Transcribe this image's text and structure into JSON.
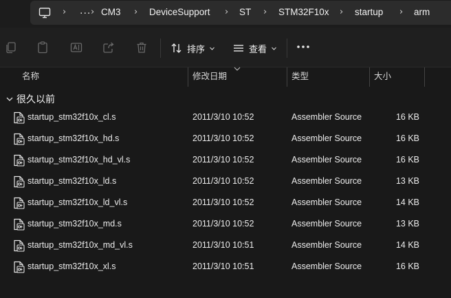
{
  "address": {
    "overflow_label": "...",
    "crumbs": [
      "CM3",
      "DeviceSupport",
      "ST",
      "STM32F10x",
      "startup",
      "arm"
    ]
  },
  "toolbar": {
    "sort_label": "排序",
    "view_label": "查看",
    "icons": [
      "copy-icon",
      "paste-icon",
      "rename-icon",
      "share-icon",
      "delete-icon"
    ]
  },
  "columns": {
    "name": "名称",
    "date": "修改日期",
    "type": "类型",
    "size": "大小"
  },
  "group": {
    "label": "很久以前"
  },
  "files": [
    {
      "name": "startup_stm32f10x_cl.s",
      "date": "2011/3/10 10:52",
      "type": "Assembler Source",
      "size": "16 KB"
    },
    {
      "name": "startup_stm32f10x_hd.s",
      "date": "2011/3/10 10:52",
      "type": "Assembler Source",
      "size": "16 KB"
    },
    {
      "name": "startup_stm32f10x_hd_vl.s",
      "date": "2011/3/10 10:52",
      "type": "Assembler Source",
      "size": "16 KB"
    },
    {
      "name": "startup_stm32f10x_ld.s",
      "date": "2011/3/10 10:52",
      "type": "Assembler Source",
      "size": "13 KB"
    },
    {
      "name": "startup_stm32f10x_ld_vl.s",
      "date": "2011/3/10 10:52",
      "type": "Assembler Source",
      "size": "14 KB"
    },
    {
      "name": "startup_stm32f10x_md.s",
      "date": "2011/3/10 10:52",
      "type": "Assembler Source",
      "size": "13 KB"
    },
    {
      "name": "startup_stm32f10x_md_vl.s",
      "date": "2011/3/10 10:51",
      "type": "Assembler Source",
      "size": "14 KB"
    },
    {
      "name": "startup_stm32f10x_xl.s",
      "date": "2011/3/10 10:51",
      "type": "Assembler Source",
      "size": "16 KB"
    }
  ]
}
